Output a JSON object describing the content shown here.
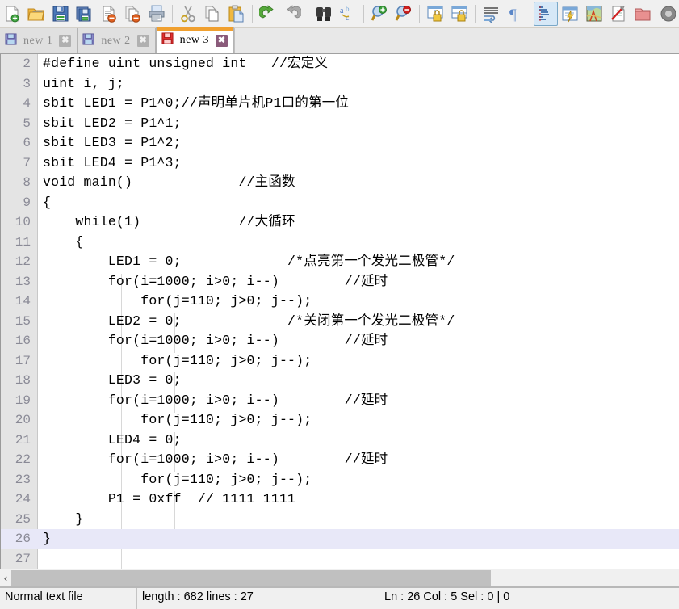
{
  "toolbar": {
    "groups": [
      [
        {
          "name": "new-file-icon",
          "title": "New"
        },
        {
          "name": "open-file-icon",
          "title": "Open"
        },
        {
          "name": "save-icon",
          "title": "Save"
        },
        {
          "name": "save-all-icon",
          "title": "Save All"
        },
        {
          "name": "close-file-icon",
          "title": "Close"
        },
        {
          "name": "close-all-icon",
          "title": "Close All"
        },
        {
          "name": "print-icon",
          "title": "Print"
        }
      ],
      [
        {
          "name": "cut-icon",
          "title": "Cut"
        },
        {
          "name": "copy-icon",
          "title": "Copy"
        },
        {
          "name": "paste-icon",
          "title": "Paste"
        }
      ],
      [
        {
          "name": "undo-icon",
          "title": "Undo"
        },
        {
          "name": "redo-icon",
          "title": "Redo"
        }
      ],
      [
        {
          "name": "find-icon",
          "title": "Find"
        },
        {
          "name": "replace-icon",
          "title": "Replace"
        }
      ],
      [
        {
          "name": "zoom-in-icon",
          "title": "Zoom In"
        },
        {
          "name": "zoom-out-icon",
          "title": "Zoom Out"
        }
      ],
      [
        {
          "name": "sync-vertical-scroll-icon",
          "title": "Synchronize Vertical Scrolling"
        },
        {
          "name": "sync-horizontal-scroll-icon",
          "title": "Synchronize Horizontal Scrolling"
        }
      ],
      [
        {
          "name": "word-wrap-icon",
          "title": "Word wrap"
        },
        {
          "name": "show-all-characters-icon",
          "title": "Show All Characters"
        }
      ],
      [
        {
          "name": "indent-guideline-icon",
          "title": "Show Indent Guide",
          "active": true
        },
        {
          "name": "user-defined-dialog-icon",
          "title": "User-Defined Dialogue"
        },
        {
          "name": "document-map-icon",
          "title": "Document Map"
        },
        {
          "name": "function-list-icon",
          "title": "Function List"
        },
        {
          "name": "folder-as-workspace-icon",
          "title": "Folder as Workspace"
        },
        {
          "name": "monitoring-icon",
          "title": "Monitoring"
        }
      ]
    ]
  },
  "tabs": [
    {
      "label": "new 1",
      "active": false,
      "modified": false,
      "close_label": "✖"
    },
    {
      "label": "new 2",
      "active": false,
      "modified": false,
      "close_label": "✖"
    },
    {
      "label": "new 3",
      "active": true,
      "modified": true,
      "close_label": "✖"
    }
  ],
  "editor": {
    "first_visible_line": 2,
    "current_line": 26,
    "lines": [
      {
        "n": 2,
        "text": "#define uint unsigned int   //宏定义"
      },
      {
        "n": 3,
        "text": "uint i, j;"
      },
      {
        "n": 4,
        "text": "sbit LED1 = P1^0;//声明单片机P1口的第一位"
      },
      {
        "n": 5,
        "text": "sbit LED2 = P1^1;"
      },
      {
        "n": 6,
        "text": "sbit LED3 = P1^2;"
      },
      {
        "n": 7,
        "text": "sbit LED4 = P1^3;"
      },
      {
        "n": 8,
        "text": "void main()             //主函数"
      },
      {
        "n": 9,
        "text": "{"
      },
      {
        "n": 10,
        "text": "    while(1)            //大循环"
      },
      {
        "n": 11,
        "text": "    {"
      },
      {
        "n": 12,
        "text": "        LED1 = 0;             /*点亮第一个发光二极管*/"
      },
      {
        "n": 13,
        "text": "        for(i=1000; i>0; i--)        //延时"
      },
      {
        "n": 14,
        "text": "            for(j=110; j>0; j--);"
      },
      {
        "n": 15,
        "text": "        LED2 = 0;             /*关闭第一个发光二极管*/"
      },
      {
        "n": 16,
        "text": "        for(i=1000; i>0; i--)        //延时"
      },
      {
        "n": 17,
        "text": "            for(j=110; j>0; j--);"
      },
      {
        "n": 18,
        "text": "        LED3 = 0;"
      },
      {
        "n": 19,
        "text": "        for(i=1000; i>0; i--)        //延时"
      },
      {
        "n": 20,
        "text": "            for(j=110; j>0; j--);"
      },
      {
        "n": 21,
        "text": "        LED4 = 0;"
      },
      {
        "n": 22,
        "text": "        for(i=1000; i>0; i--)        //延时"
      },
      {
        "n": 23,
        "text": "            for(j=110; j>0; j--);"
      },
      {
        "n": 24,
        "text": "        P1 = 0xff  // 1111 1111"
      },
      {
        "n": 25,
        "text": "    }"
      },
      {
        "n": 26,
        "text": "}"
      },
      {
        "n": 27,
        "text": ""
      }
    ]
  },
  "hscroll": {
    "left_arrow": "‹"
  },
  "statusbar": {
    "file_type": "Normal text file",
    "length_lines": "length : 682   lines : 27",
    "position": "Ln : 26   Col : 5   Sel : 0 | 0"
  },
  "colors": {
    "accent_orange": "#f0a030",
    "gutter_bg": "#e4e4e4",
    "current_line_bg": "#e8e8f8",
    "caret": "#800080"
  }
}
